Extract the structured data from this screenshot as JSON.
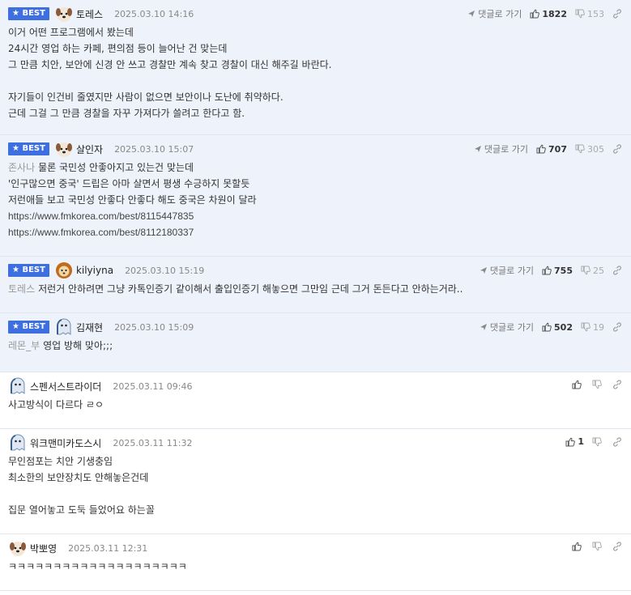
{
  "labels": {
    "best": "★ BEST",
    "reply": "댓글로 가기"
  },
  "colors": {
    "best_badge": "#3d6fe0",
    "best_row_bg": "#eef2fb"
  },
  "icons": {
    "reply": "reply-arrow-icon",
    "upvote": "thumbs-up-icon",
    "downvote": "thumbs-down-icon",
    "link": "link-icon"
  },
  "comments": [
    {
      "author": "토레스",
      "time": "2025.03.10 14:16",
      "up": "1822",
      "down": "153",
      "lines": [
        "이거 어떤 프로그램에서 봤는데",
        "24시간 영업 하는 카페, 편의점 등이 늘어난 건 맞는데",
        "그 만큼 치안, 보안에 신경 안 쓰고 경찰만 계속 찾고 경찰이 대신 해주길 바란다.",
        "",
        "자기들이 인건비 줄였지만 사람이 없으면 보안이나 도난에 취약하다.",
        "근데 그걸 그 만큼 경찰을 자꾸 가져다가 쓸려고 한다고 함."
      ]
    },
    {
      "author": "살인자",
      "time": "2025.03.10 15:07",
      "up": "707",
      "down": "305",
      "mention": "존사나",
      "first": "물론 국민성 안좋아지고 있는건 맞는데",
      "lines": [
        "'인구많으면 중국' 드립은 아마 살면서 평생 수긍하지 못할듯",
        "저런애들 보고 국민성 안좋다 안좋다 해도 중국은 차원이 달라"
      ],
      "links": [
        "https://www.fmkorea.com/best/8115447835",
        "https://www.fmkorea.com/best/8112180337"
      ]
    },
    {
      "author": "kilyiyna",
      "time": "2025.03.10 15:19",
      "up": "755",
      "down": "25",
      "mention": "토레스",
      "first": "저런거 안하려면 그냥 카톡인증기 같이해서 출입인증기 해놓으면 그만임 근데 그거 돈든다고 안하는거라.."
    },
    {
      "author": "김재현",
      "time": "2025.03.10 15:09",
      "up": "502",
      "down": "19",
      "mention": "레몬_부",
      "first": "영업 방해 맞아;;;"
    },
    {
      "author": "스펜서스트라이더",
      "time": "2025.03.11 09:46",
      "lines": [
        "사고방식이 다르다 ㄹㅇ"
      ]
    },
    {
      "author": "워크맨미카도스시",
      "time": "2025.03.11 11:32",
      "up": "1",
      "lines": [
        "무인점포는 치안 기생충임",
        "최소한의 보안장치도 안해놓은건데",
        "",
        "집문 열어놓고 도둑 들었어요 하는꼴"
      ]
    },
    {
      "author": "박뽀영",
      "time": "2025.03.11 12:31",
      "lines": [
        "ㅋㅋㅋㅋㅋㅋㅋㅋㅋㅋㅋㅋㅋㅋㅋㅋㅋㅋㅋㅋ"
      ]
    }
  ]
}
